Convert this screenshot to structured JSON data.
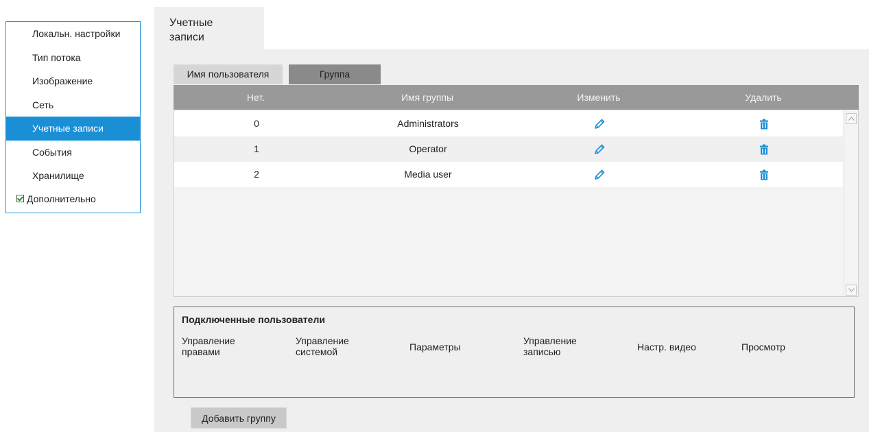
{
  "sidebar": {
    "items": [
      {
        "label": "Локальн. настройки"
      },
      {
        "label": "Тип потока"
      },
      {
        "label": "Изображение"
      },
      {
        "label": "Сеть"
      },
      {
        "label": "Учетные записи",
        "active": true
      },
      {
        "label": "События"
      },
      {
        "label": "Хранилище"
      }
    ],
    "advanced_label": "Дополнительно",
    "advanced_checked": true
  },
  "top_tab": {
    "line1": "Учетные",
    "line2": "записи"
  },
  "sub_tabs": {
    "user": "Имя пользователя",
    "group": "Группа"
  },
  "table": {
    "headers": {
      "no": "Нет.",
      "name": "Имя группы",
      "edit": "Изменить",
      "delete": "Удалить"
    },
    "rows": [
      {
        "no": "0",
        "name": "Administrators"
      },
      {
        "no": "1",
        "name": "Operator"
      },
      {
        "no": "2",
        "name": "Media user"
      }
    ],
    "edit_icon": "pencil-icon",
    "delete_icon": "trash-icon"
  },
  "connected": {
    "title": "Подключенные пользователи",
    "permissions": [
      {
        "line1": "Управление",
        "line2": "правами"
      },
      {
        "line1": "Управление",
        "line2": "системой"
      },
      {
        "line1": "Параметры",
        "line2": ""
      },
      {
        "line1": "Управление",
        "line2": "записью"
      },
      {
        "line1": "Настр. видео",
        "line2": ""
      },
      {
        "line1": "Просмотр",
        "line2": ""
      }
    ]
  },
  "buttons": {
    "add_group": "Добавить группу"
  },
  "colors": {
    "accent": "#1a8fd6",
    "header": "#999999",
    "panel": "#efefef"
  }
}
